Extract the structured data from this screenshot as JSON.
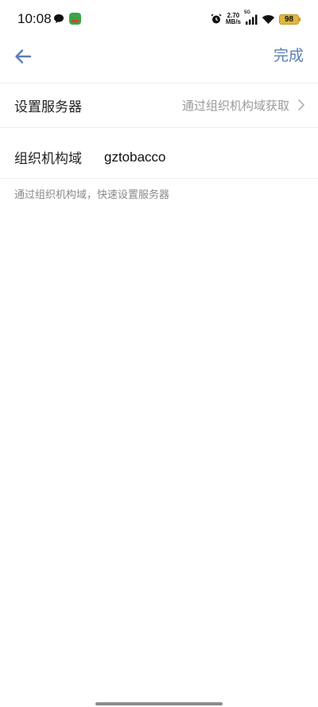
{
  "status_bar": {
    "time": "10:08",
    "net_speed_value": "2.70",
    "net_speed_unit": "MB/s",
    "network_type": "5G",
    "battery": "98"
  },
  "nav": {
    "done_label": "完成"
  },
  "server_row": {
    "label": "设置服务器",
    "value": "通过组织机构域获取"
  },
  "org_row": {
    "label": "组织机构域",
    "input_value": "gztobacco"
  },
  "hint": "通过组织机构域，快速设置服务器",
  "colors": {
    "accent": "#5b7fb5",
    "battery": "#e0b640"
  }
}
